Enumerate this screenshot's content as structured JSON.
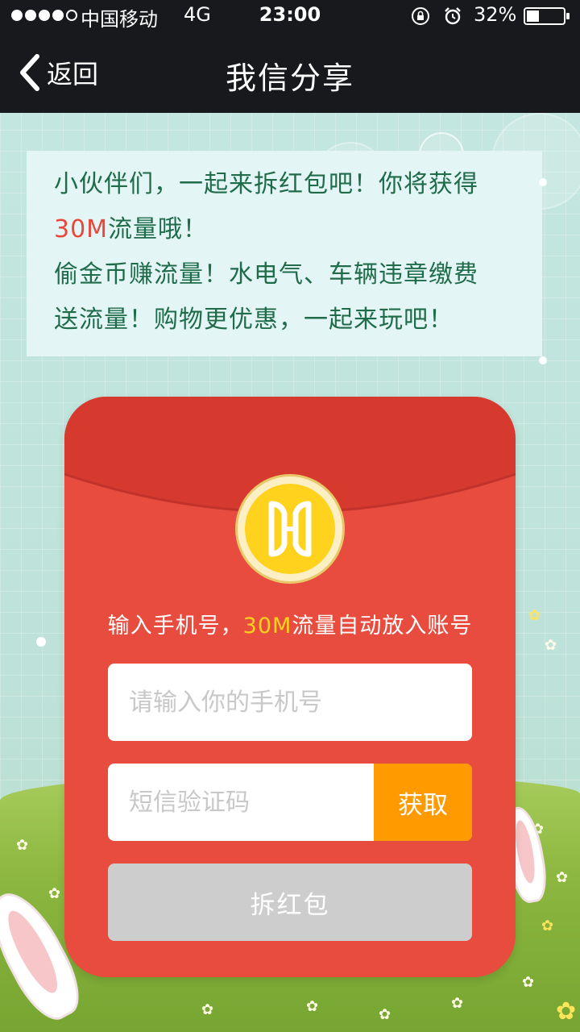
{
  "status_bar": {
    "carrier": "中国移动",
    "network": "4G",
    "time": "23:00",
    "battery": "32%",
    "icons": [
      "signal-dots-icon",
      "rotation-lock-icon",
      "alarm-icon",
      "battery-icon"
    ]
  },
  "nav": {
    "back_label": "返回",
    "title": "我信分享"
  },
  "speech": {
    "line1": "小伙伴们，一起来拆红包吧！你将获得",
    "line2_highlight": "30M",
    "line2_rest": "流量哦！",
    "line3": "偷金币赚流量！水电气、车辆违章缴费",
    "line4": "送流量！购物更优惠，一起来玩吧！"
  },
  "envelope": {
    "tip_prefix": "输入手机号，",
    "tip_highlight": "30M",
    "tip_suffix": "流量自动放入账号",
    "phone_placeholder": "请输入你的手机号",
    "phone_value": "",
    "code_placeholder": "短信验证码",
    "code_value": "",
    "get_code_label": "获取",
    "open_label": "拆红包"
  },
  "colors": {
    "nav_bg": "#17191c",
    "envelope_red": "#e84c3e",
    "envelope_flap": "#d63a2e",
    "coin_yellow": "#ffd21e",
    "get_button": "#ff9a00",
    "open_button_disabled": "#cdcdcd",
    "speech_text": "#1f6b4a",
    "highlight_red": "#e8473c"
  }
}
